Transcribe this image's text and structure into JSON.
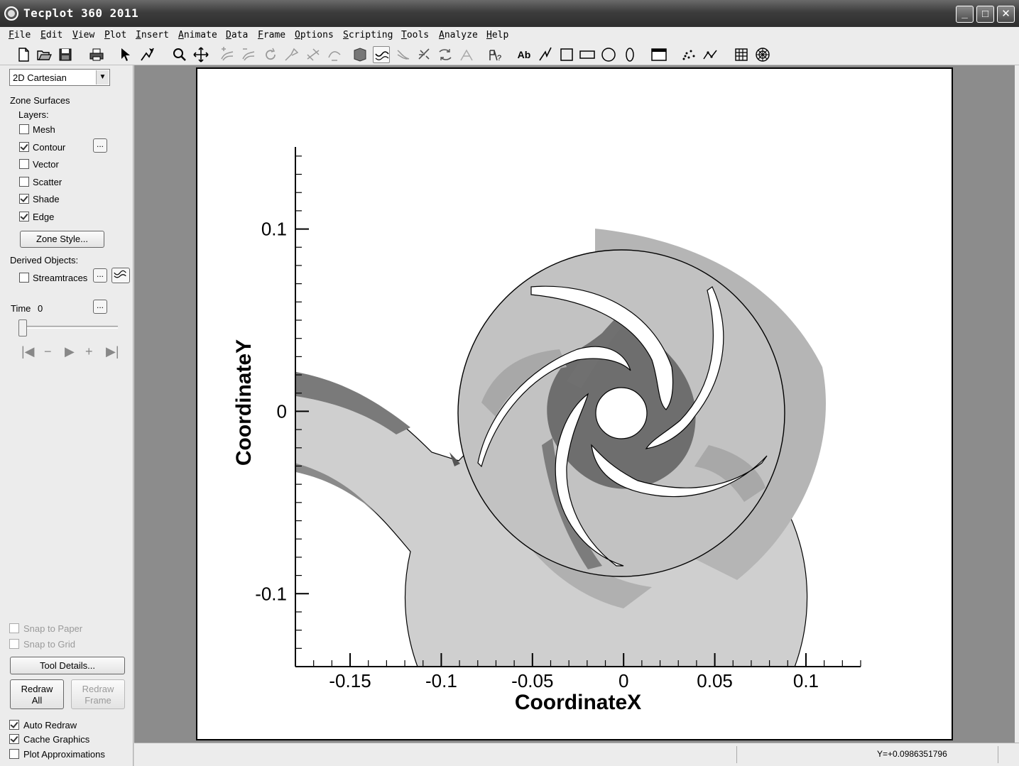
{
  "window": {
    "title": "Tecplot 360 2011",
    "minimize": "_",
    "maximize": "□",
    "close": "✕"
  },
  "menu": [
    "File",
    "Edit",
    "View",
    "Plot",
    "Insert",
    "Animate",
    "Data",
    "Frame",
    "Options",
    "Scripting",
    "Tools",
    "Analyze",
    "Help"
  ],
  "toolbar": {
    "icons": [
      "new-file-icon",
      "open-file-icon",
      "save-icon",
      "print-icon",
      "selector-icon",
      "adjustor-icon",
      "zoom-icon",
      "translate-icon",
      "contour-add-icon",
      "contour-remove-icon",
      "rotate-icon",
      "probe-icon",
      "slice-icon",
      "extract-icon",
      "streamtrace-icon",
      "rake-icon",
      "zone-effect-icon",
      "isosurface-icon",
      "mesh-tool-icon",
      "text-icon",
      "polyline-icon",
      "square-icon",
      "rectangle-icon",
      "circle-icon",
      "ellipse-icon",
      "frame-icon",
      "scatter-icon",
      "line-plot-icon",
      "grid-icon",
      "polar-icon"
    ],
    "text_tool": "Ab",
    "pressed_tool": "streamtrace-icon"
  },
  "sidebar": {
    "plot_type": "2D Cartesian",
    "zone_surfaces": "Zone Surfaces",
    "layers_label": "Layers:",
    "layers": [
      {
        "label": "Mesh",
        "checked": false
      },
      {
        "label": "Contour",
        "checked": true
      },
      {
        "label": "Vector",
        "checked": false
      },
      {
        "label": "Scatter",
        "checked": false
      },
      {
        "label": "Shade",
        "checked": true
      },
      {
        "label": "Edge",
        "checked": true
      }
    ],
    "zone_style": "Zone Style...",
    "derived_objects": "Derived Objects:",
    "streamtraces": {
      "label": "Streamtraces",
      "checked": false
    },
    "time_label": "Time",
    "time_value": "0",
    "ellipsis": "...",
    "snap_to_paper": {
      "label": "Snap to Paper",
      "checked": false
    },
    "snap_to_grid": {
      "label": "Snap to Grid",
      "checked": false
    },
    "tool_details": "Tool Details...",
    "redraw_all_line1": "Redraw",
    "redraw_all_line2": "All",
    "redraw_frame_line1": "Redraw",
    "redraw_frame_line2": "Frame",
    "auto_redraw": {
      "label": "Auto Redraw",
      "checked": true
    },
    "cache_graphics": {
      "label": "Cache Graphics",
      "checked": true
    },
    "plot_approximations": {
      "label": "Plot Approximations",
      "checked": false
    }
  },
  "status": {
    "coordinate": "Y=+0.0986351796"
  },
  "plot": {
    "xlabel": "CoordinateX",
    "ylabel": "CoordinateY",
    "xticks": [
      "-0.15",
      "-0.1",
      "-0.05",
      "0",
      "0.05",
      "0.1"
    ],
    "yticks": [
      "0.1",
      "0",
      "-0.1"
    ],
    "xrange": [
      -0.18,
      0.13
    ],
    "yrange": [
      -0.14,
      0.145
    ],
    "blade_count": 5,
    "colors": {
      "light": "#cfcfcf",
      "mid": "#b3b3b3",
      "dark": "#6e6e6e",
      "background": "#ffffff"
    }
  }
}
